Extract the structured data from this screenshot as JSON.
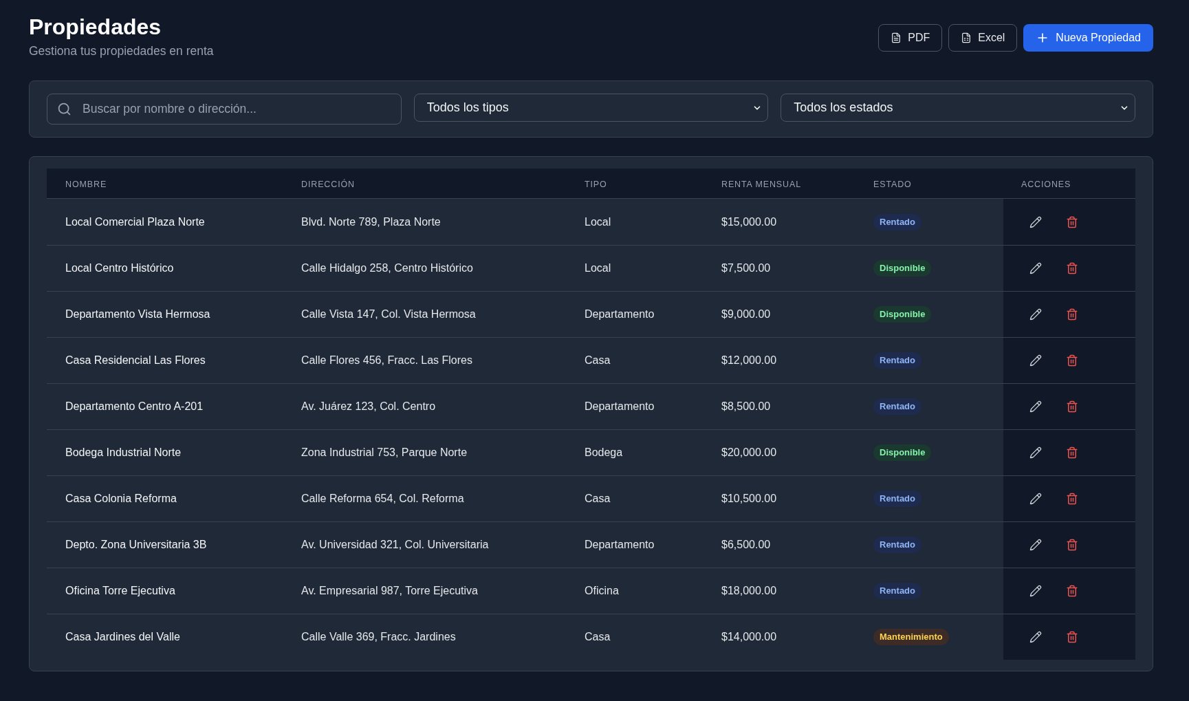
{
  "header": {
    "title": "Propiedades",
    "subtitle": "Gestiona tus propiedades en renta"
  },
  "actions": [
    {
      "label": "PDF",
      "kind": "pdf"
    },
    {
      "label": "Excel",
      "kind": "excel"
    },
    {
      "label": "Nueva Propiedad",
      "kind": "new"
    }
  ],
  "filters": {
    "search": {
      "placeholder": "Buscar por nombre o dirección..."
    },
    "type_select": {
      "value": "Todos los tipos"
    },
    "status_select": {
      "value": "Todos los estados"
    }
  },
  "table": {
    "columns": [
      "NOMBRE",
      "DIRECCIÓN",
      "TIPO",
      "RENTA MENSUAL",
      "ESTADO",
      "ACCIONES"
    ],
    "rows": [
      {
        "name": "Local Comercial Plaza Norte",
        "address": "Blvd. Norte 789, Plaza Norte",
        "type": "Local",
        "rent": "$15,000.00",
        "status": {
          "label": "Rentado",
          "kind": "rented"
        }
      },
      {
        "name": "Local Centro Histórico",
        "address": "Calle Hidalgo 258, Centro Histórico",
        "type": "Local",
        "rent": "$7,500.00",
        "status": {
          "label": "Disponible",
          "kind": "available"
        }
      },
      {
        "name": "Departamento Vista Hermosa",
        "address": "Calle Vista 147, Col. Vista Hermosa",
        "type": "Departamento",
        "rent": "$9,000.00",
        "status": {
          "label": "Disponible",
          "kind": "available"
        }
      },
      {
        "name": "Casa Residencial Las Flores",
        "address": "Calle Flores 456, Fracc. Las Flores",
        "type": "Casa",
        "rent": "$12,000.00",
        "status": {
          "label": "Rentado",
          "kind": "rented"
        }
      },
      {
        "name": "Departamento Centro A-201",
        "address": "Av. Juárez 123, Col. Centro",
        "type": "Departamento",
        "rent": "$8,500.00",
        "status": {
          "label": "Rentado",
          "kind": "rented"
        }
      },
      {
        "name": "Bodega Industrial Norte",
        "address": "Zona Industrial 753, Parque Norte",
        "type": "Bodega",
        "rent": "$20,000.00",
        "status": {
          "label": "Disponible",
          "kind": "available"
        }
      },
      {
        "name": "Casa Colonia Reforma",
        "address": "Calle Reforma 654, Col. Reforma",
        "type": "Casa",
        "rent": "$10,500.00",
        "status": {
          "label": "Rentado",
          "kind": "rented"
        }
      },
      {
        "name": "Depto. Zona Universitaria 3B",
        "address": "Av. Universidad 321, Col. Universitaria",
        "type": "Departamento",
        "rent": "$6,500.00",
        "status": {
          "label": "Rentado",
          "kind": "rented"
        }
      },
      {
        "name": "Oficina Torre Ejecutiva",
        "address": "Av. Empresarial 987, Torre Ejecutiva",
        "type": "Oficina",
        "rent": "$18,000.00",
        "status": {
          "label": "Rentado",
          "kind": "rented"
        }
      },
      {
        "name": "Casa Jardines del Valle",
        "address": "Calle Valle 369, Fracc. Jardines",
        "type": "Casa",
        "rent": "$14,000.00",
        "status": {
          "label": "Mantenimiento",
          "kind": "maintenance"
        }
      }
    ]
  }
}
